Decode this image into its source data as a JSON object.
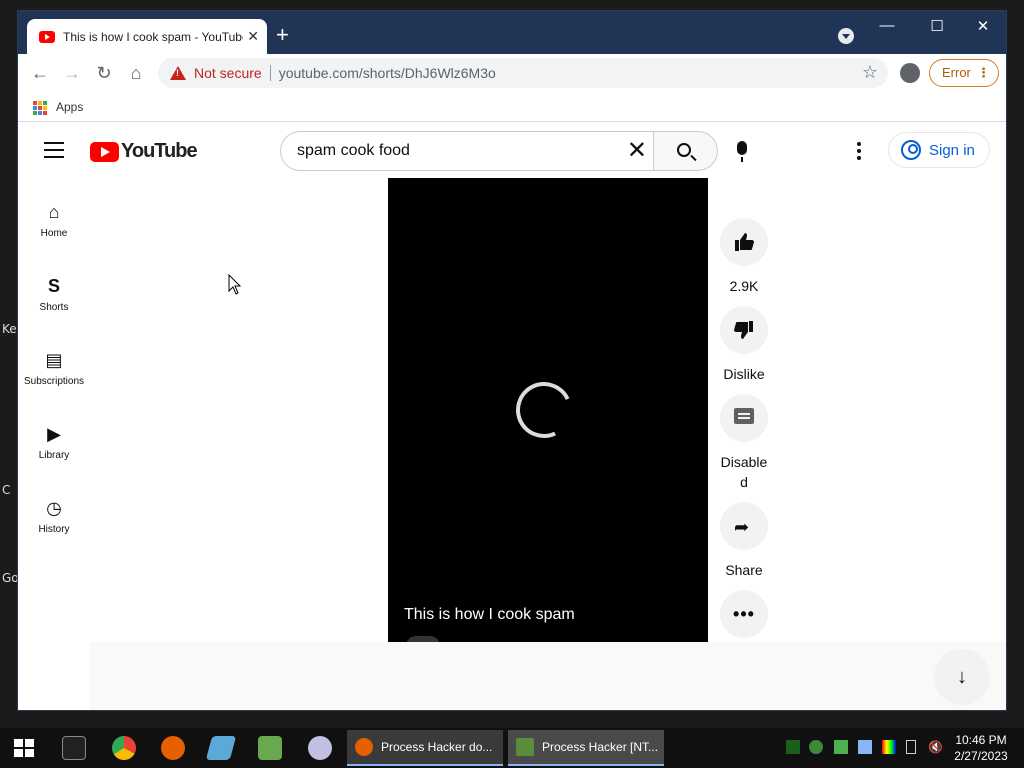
{
  "desktop": {
    "labels": [
      "Ke",
      "C",
      "Go"
    ]
  },
  "browser": {
    "tab_title": "This is how I cook spam - YouTube",
    "tab_close": "✕",
    "new_tab": "+",
    "window_controls": {
      "minimize": "—",
      "maximize": "☐",
      "close": "✕"
    },
    "nav": {
      "back": "←",
      "forward": "→",
      "reload": "↻",
      "home": "⌂"
    },
    "security_label": "Not secure",
    "url": "youtube.com/shorts/DhJ6Wlz6M3o",
    "bookmark_star": "☆",
    "error_button": "Error",
    "bookmarks": {
      "apps_label": "Apps"
    }
  },
  "youtube": {
    "logo_text": "YouTube",
    "search": {
      "value": "spam cook food",
      "clear": "✕"
    },
    "signin_label": "Sign in",
    "guide": [
      {
        "label": "Home",
        "icon": "home-icon",
        "glyph": "⌂"
      },
      {
        "label": "Shorts",
        "icon": "shorts-icon",
        "glyph": "S"
      },
      {
        "label": "Subscriptions",
        "icon": "subscriptions-icon",
        "glyph": "▤"
      },
      {
        "label": "Library",
        "icon": "library-icon",
        "glyph": "▶"
      },
      {
        "label": "History",
        "icon": "history-icon",
        "glyph": "◷"
      }
    ],
    "video": {
      "title": "This is how I cook spam"
    },
    "actions": {
      "like_count": "2.9K",
      "dislike_label": "Dislike",
      "comments_label": "Disable\nd",
      "share_label": "Share",
      "more_glyph": "•••"
    },
    "scroll_down_glyph": "↓"
  },
  "taskbar": {
    "tasks": [
      {
        "label": "Process Hacker do...",
        "icon_color": "#e66000"
      },
      {
        "label": "Process Hacker [NT...",
        "icon_color": "#5a8c3c"
      }
    ],
    "clock": {
      "time": "10:46 PM",
      "date": "2/27/2023"
    }
  },
  "colors": {
    "tabstrip": "#203456",
    "youtube_red": "#ff0000",
    "link_blue": "#065fd4",
    "warning_red": "#c5221f",
    "error_orange": "#d97b22"
  }
}
